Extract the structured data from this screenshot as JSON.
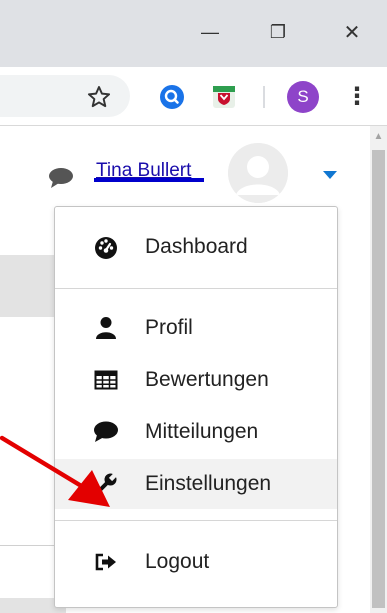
{
  "window": {
    "minimize_glyph": "—",
    "restore_glyph": "❐",
    "close_glyph": "✕"
  },
  "toolbar": {
    "bookmark_icon": "star-icon",
    "extensions": [
      "search-extension-icon",
      "shield-extension-icon"
    ],
    "profile_initial": "S",
    "profile_color": "#8e44c9",
    "menu_glyph": "⋮"
  },
  "header": {
    "user_name": "Tina Bullert",
    "message_icon": "speech-bubble-icon",
    "dropdown_icon": "caret-down-icon"
  },
  "menu": {
    "items": [
      {
        "label": "Dashboard",
        "icon": "dashboard-icon"
      },
      {
        "label": "Profil",
        "icon": "user-icon"
      },
      {
        "label": "Bewertungen",
        "icon": "grid-icon"
      },
      {
        "label": "Mitteilungen",
        "icon": "message-icon"
      },
      {
        "label": "Einstellungen",
        "icon": "wrench-icon"
      },
      {
        "label": "Logout",
        "icon": "logout-icon"
      }
    ]
  },
  "colors": {
    "link": "#1a0dab",
    "annotation_arrow": "#e30000",
    "accent_caret": "#1177d1"
  }
}
